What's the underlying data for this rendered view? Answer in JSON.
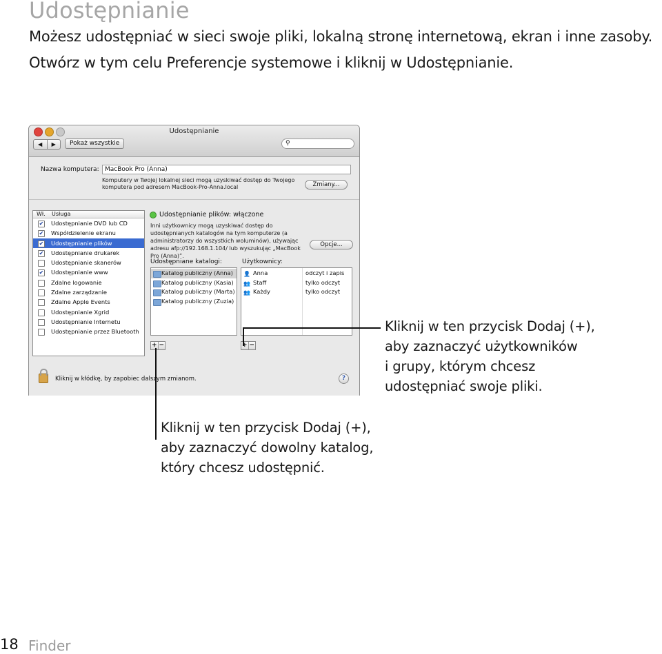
{
  "heading": "Udostępnianie",
  "intro_lines": [
    "Możesz udostępniać w sieci swoje pliki, lokalną stronę internetową, ekran i inne zasoby.",
    "Otwórz w tym celu Preferencje systemowe i kliknij w Udostępnianie."
  ],
  "window": {
    "title": "Udostępnianie",
    "back_label": "◀",
    "forward_label": "▶",
    "show_all": "Pokaż wszystkie",
    "search_icon": "search-icon",
    "computer_name_label": "Nazwa komputera:",
    "computer_name_value": "MacBook Pro (Anna)",
    "computer_note": [
      "Komputery w Twojej lokalnej sieci mogą uzyskiwać dostęp do Twojego",
      "komputera pod adresem MacBook-Pro-Anna.local"
    ],
    "edit_button": "Zmiany...",
    "services_header_on": "Wł.",
    "services_header_service": "Usługa",
    "services": [
      {
        "name": "Udostępnianie DVD lub CD",
        "checked": true,
        "selected": false
      },
      {
        "name": "Współdzielenie ekranu",
        "checked": true,
        "selected": false
      },
      {
        "name": "Udostępnianie plików",
        "checked": true,
        "selected": true
      },
      {
        "name": "Udostępnianie drukarek",
        "checked": true,
        "selected": false
      },
      {
        "name": "Udostępnianie skanerów",
        "checked": false,
        "selected": false
      },
      {
        "name": "Udostępnianie www",
        "checked": true,
        "selected": false
      },
      {
        "name": "Zdalne logowanie",
        "checked": false,
        "selected": false
      },
      {
        "name": "Zdalne zarządzanie",
        "checked": false,
        "selected": false
      },
      {
        "name": "Zdalne Apple Events",
        "checked": false,
        "selected": false
      },
      {
        "name": "Udostępnianie Xgrid",
        "checked": false,
        "selected": false
      },
      {
        "name": "Udostępnianie Internetu",
        "checked": false,
        "selected": false
      },
      {
        "name": "Udostępnianie przez Bluetooth",
        "checked": false,
        "selected": false
      }
    ],
    "status_title": "Udostępnianie plików: włączone",
    "status_desc": [
      "Inni użytkownicy mogą uzyskiwać dostęp do",
      "udostępnianych katalogów na tym komputerze (a",
      "administratorzy do wszystkich woluminów), używając",
      "adresu afp://192.168.1.104/ lub wyszukując „MacBook",
      "Pro (Anna)”."
    ],
    "options_button": "Opcje...",
    "shared_folders_label": "Udostępniane katalogi:",
    "users_label": "Użytkownicy:",
    "folders": [
      {
        "name": "Katalog publiczny (Anna)",
        "selected": true
      },
      {
        "name": "Katalog publiczny (Kasia)",
        "selected": false
      },
      {
        "name": "Katalog publiczny (Marta)",
        "selected": false
      },
      {
        "name": "Katalog publiczny (Zuzia)",
        "selected": false
      }
    ],
    "users": [
      {
        "name": "Anna",
        "permission": "odczyt i zapis"
      },
      {
        "name": "Staff",
        "permission": "tylko odczyt"
      },
      {
        "name": "Każdy",
        "permission": "tylko odczyt"
      }
    ],
    "plus_label": "+",
    "minus_label": "−",
    "lock_text": "Kliknij w kłódkę, by zapobiec dalszym zmianom.",
    "help_label": "?"
  },
  "callout_right": [
    "Kliknij w ten przycisk Dodaj (+),",
    "aby zaznaczyć użytkowników",
    "i grupy, którym chcesz",
    "udostępniać swoje pliki."
  ],
  "callout_bottom": [
    "Kliknij w ten przycisk Dodaj (+),",
    "aby zaznaczyć dowolny katalog,",
    "który chcesz udostępnić."
  ],
  "footer": {
    "page_number": "18",
    "section": "Finder"
  }
}
